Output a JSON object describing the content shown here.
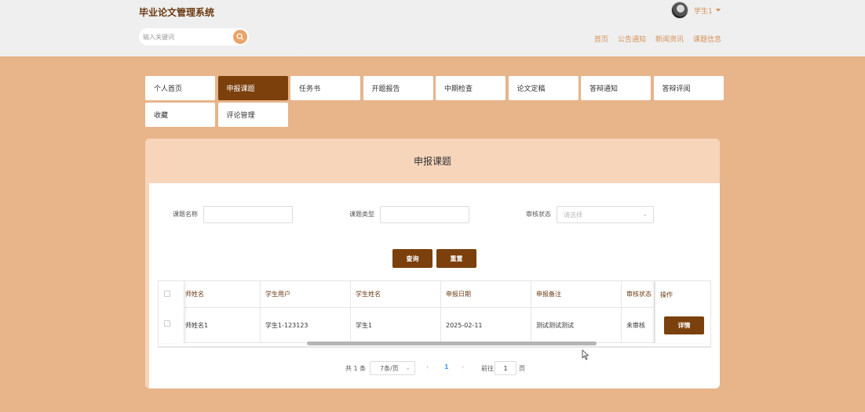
{
  "header": {
    "site_title": "毕业论文管理系统",
    "user_name": "学生1",
    "search_placeholder": "输入关键词",
    "nav": [
      "首页",
      "公告通知",
      "新闻资讯",
      "课题信息"
    ]
  },
  "tabs": [
    {
      "label": "个人首页",
      "active": false
    },
    {
      "label": "申报课题",
      "active": true
    },
    {
      "label": "任务书",
      "active": false
    },
    {
      "label": "开题报告",
      "active": false
    },
    {
      "label": "中期检查",
      "active": false
    },
    {
      "label": "论文定稿",
      "active": false
    },
    {
      "label": "答辩通知",
      "active": false
    },
    {
      "label": "答辩评阅",
      "active": false
    },
    {
      "label": "收藏",
      "active": false
    },
    {
      "label": "评论管理",
      "active": false
    }
  ],
  "panel": {
    "title": "申报课题",
    "filters": {
      "topic_name_label": "课题名称",
      "topic_type_label": "课题类型",
      "review_status_label": "审核状态",
      "review_status_placeholder": "请选择"
    },
    "query_label": "查询",
    "reset_label": "重置"
  },
  "table": {
    "headers": [
      "师姓名",
      "学生用户",
      "学生姓名",
      "申报日期",
      "申报备注",
      "审核状态",
      "操作"
    ],
    "rows": [
      {
        "teacher_name": "师姓名1",
        "student_user": "学生1-123123",
        "student_name": "学生1",
        "date": "2025-02-11",
        "note": "测试测试测试",
        "status": "未审核",
        "action": "详情"
      }
    ]
  },
  "pagination": {
    "total": "共 1 条",
    "page_size": "7条/页",
    "current_page": "1",
    "goto_label": "前往",
    "goto_value": "1",
    "page_suffix": "页"
  },
  "colors": {
    "brand": "#7b400c",
    "accent": "#d4925a",
    "background": "#e8b48a",
    "panel_header": "#f7d5bb",
    "link_active": "#409eff"
  }
}
